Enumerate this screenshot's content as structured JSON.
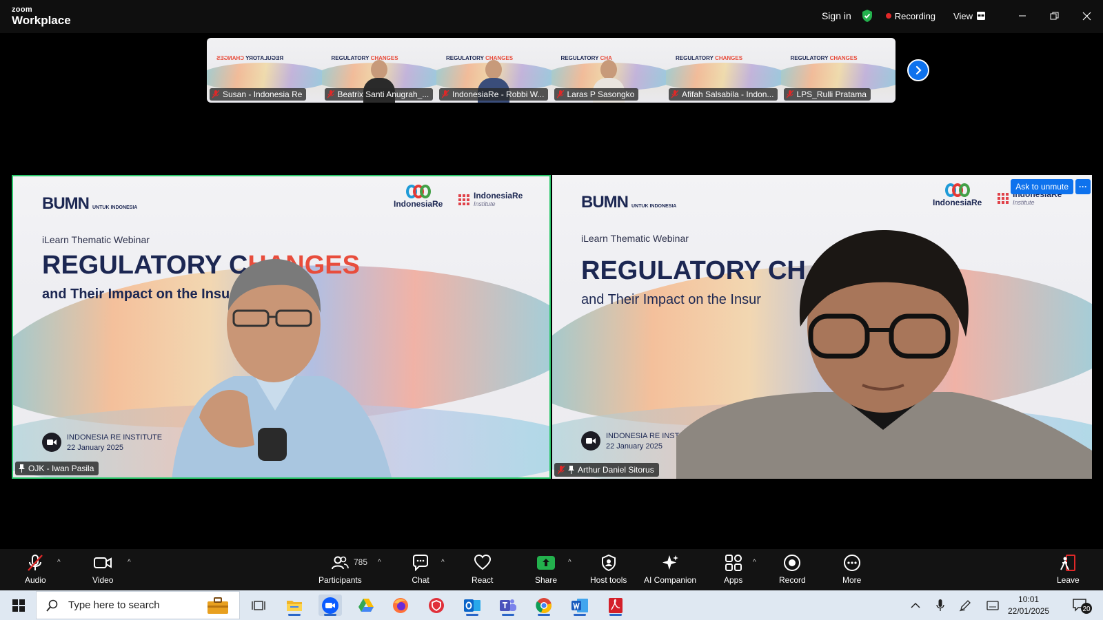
{
  "app": {
    "brand_top": "zoom",
    "brand_bottom": "Workplace",
    "sign_in": "Sign in",
    "recording": "Recording",
    "view": "View"
  },
  "thumbnails": [
    {
      "name": "Susan - Indonesia Re",
      "title_main": "REGULATORY",
      "title_accent": "CHANGES",
      "person": false,
      "mirrored": true
    },
    {
      "name": "Beatrix Santi Anugrah_...",
      "title_main": "REGULATORY",
      "title_accent": "CHANGES",
      "person": true,
      "person_color": "#2a2a2a"
    },
    {
      "name": "IndonesiaRe - Robbi W...",
      "title_main": "REGULATORY",
      "title_accent": "CHANGES",
      "person": true,
      "person_color": "#3a4d7a"
    },
    {
      "name": "Laras P Sasongko",
      "title_main": "REGULATORY",
      "title_accent": "CHA",
      "person": true,
      "person_color": "#e9e4de"
    },
    {
      "name": "Afifah Salsabila - Indon...",
      "title_main": "REGULATORY",
      "title_accent": "CHANGES",
      "person": false
    },
    {
      "name": "LPS_Rulli Pratama",
      "title_main": "REGULATORY",
      "title_accent": "CHANGES",
      "person": false
    }
  ],
  "tiles": [
    {
      "name": "OJK - Iwan Pasila",
      "webinar": "iLearn Thematic Webinar",
      "headline_main": "REGULATORY C",
      "headline_accent": "HANGES",
      "subtitle": "and Their Impact on the Insu         stry",
      "event_org": "INDONESIA RE INSTITUTE",
      "event_date": "22 January 2025",
      "bumn": "BUMN",
      "bumn_small": "UNTUK INDONESIA",
      "ire": "IndonesiaRe",
      "iri": "IndonesiaRe",
      "iri_sub": "Institute"
    },
    {
      "name": "Arthur Daniel Sitorus",
      "webinar": "iLearn Thematic Webinar",
      "headline_main": "REGULATORY CH",
      "headline_accent": "",
      "subtitle": "and Their Impact on the Insur",
      "event_org": "INDONESIA RE INSTITUT",
      "event_date": "22 January 2025",
      "bumn": "BUMN",
      "bumn_small": "UNTUK INDONESIA",
      "ire": "IndonesiaRe",
      "iri": "IndonesiaRe",
      "iri_sub": "Institute",
      "ask_to_unmute": "Ask to unmute",
      "more": "···"
    }
  ],
  "toolbar": {
    "audio": "Audio",
    "video": "Video",
    "participants": "Participants",
    "participants_count": "785",
    "chat": "Chat",
    "react": "React",
    "share": "Share",
    "host_tools": "Host tools",
    "ai_companion": "AI Companion",
    "apps": "Apps",
    "record": "Record",
    "more": "More",
    "leave": "Leave"
  },
  "taskbar": {
    "search_placeholder": "Type here to search",
    "time": "10:01",
    "date": "22/01/2025",
    "notifications": "20"
  },
  "colors": {
    "accent_blue": "#0e72ed",
    "active_speaker": "#2ac86b",
    "record_red": "#e02828",
    "slide_navy": "#1c2752",
    "slide_accent": "#e84d3c"
  }
}
